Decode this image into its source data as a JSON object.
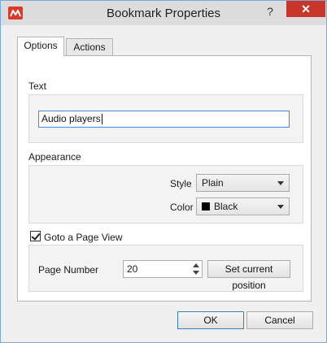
{
  "window": {
    "title": "Bookmark Properties",
    "help_glyph": "?",
    "close_glyph": "✕"
  },
  "tabs": [
    {
      "label": "Options"
    },
    {
      "label": "Actions"
    }
  ],
  "text_section": {
    "label": "Text",
    "value": "Audio players"
  },
  "appearance": {
    "label": "Appearance",
    "style_label": "Style",
    "style_value": "Plain",
    "color_label": "Color",
    "color_value": "Black",
    "color_hex": "#000000"
  },
  "goto": {
    "checkbox_label": "Goto a Page View",
    "checked": true,
    "page_number_label": "Page Number",
    "page_number_value": "20",
    "set_position_label": "Set current position"
  },
  "footer": {
    "ok_label": "OK",
    "cancel_label": "Cancel"
  },
  "colors": {
    "title_bar": "#dcdcdc",
    "close_button": "#c7352b",
    "focus_border": "#4a8ad4",
    "app_icon": "#d83a2c"
  }
}
